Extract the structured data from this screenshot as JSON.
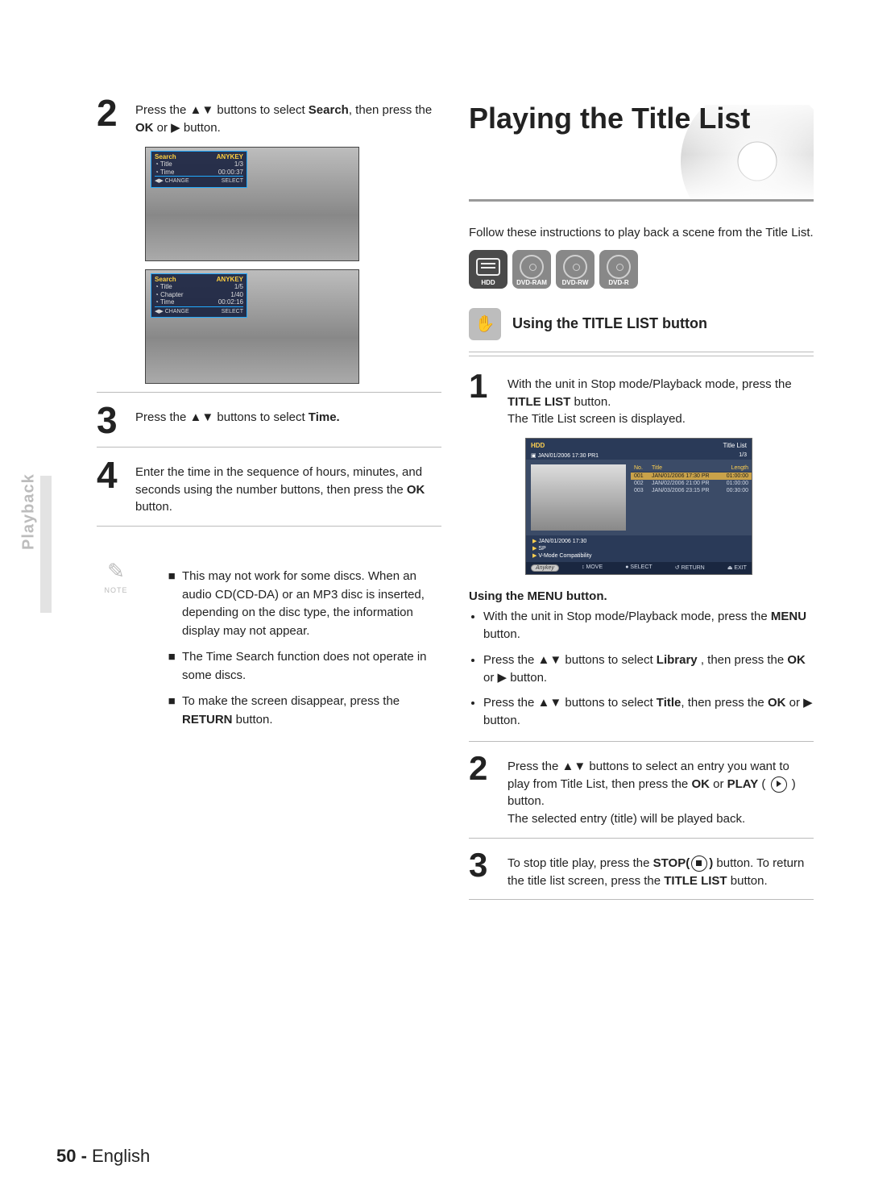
{
  "side_tab": "Playback",
  "footer": {
    "page": "50 -",
    "lang": "English"
  },
  "left": {
    "step2": {
      "pre": "Press the ▲▼ buttons to select ",
      "bold": "Search",
      "post": ", then press the ",
      "bold2": "OK",
      "tail": " or ▶ button."
    },
    "ss1": {
      "hdr_l": "Search",
      "hdr_r": "ANYKEY",
      "r1a": "Title",
      "r1b": "1/3",
      "r2a": "Time",
      "r2b": "00:00:37",
      "botL": "◀▶ CHANGE",
      "botR": "SELECT"
    },
    "ss2": {
      "hdr_l": "Search",
      "hdr_r": "ANYKEY",
      "r1a": "Title",
      "r1b": "1/5",
      "r2a": "Chapter",
      "r2b": "1/40",
      "r3a": "Time",
      "r3b": "00:02:16",
      "botL": "◀▶ CHANGE",
      "botR": "SELECT"
    },
    "step3": {
      "pre": "Press the ▲▼ buttons to select ",
      "bold": "Time."
    },
    "step4": {
      "text": "Enter the time in the sequence of hours, minutes, and seconds using the number buttons, then press the ",
      "bold": "OK",
      "tail": " button."
    },
    "note_label": "NOTE",
    "notes": [
      "This may not work for some discs. When an audio CD(CD-DA) or an MP3 disc is inserted, depending on the disc type, the information display may not appear.",
      "The Time Search function does not operate in some discs.",
      {
        "pre": "To make the screen disappear, press the ",
        "bold": "RETURN",
        "post": " button."
      }
    ]
  },
  "right": {
    "banner_title": "Playing the Title List",
    "intro": "Follow these instructions to play back a scene from the Title List.",
    "media": [
      "HDD",
      "DVD-RAM",
      "DVD-RW",
      "DVD-R"
    ],
    "subhead": "Using the TITLE LIST button",
    "step1": {
      "a": "With the unit in Stop mode/Playback mode, press the ",
      "bold": "TITLE LIST",
      "b": " button.",
      "c": "The Title List screen is displayed."
    },
    "tls": {
      "top_label": "HDD",
      "top_title": "Title List",
      "top_count": "1/3",
      "date_line": "JAN/01/2006 17:30 PR1",
      "head": [
        "No.",
        "Title",
        "Length"
      ],
      "rows": [
        {
          "n": "001",
          "t": "JAN/01/2006 17:30 PR",
          "l": "01:00:00"
        },
        {
          "n": "002",
          "t": "JAN/02/2006 21:00 PR",
          "l": "01:00:00"
        },
        {
          "n": "003",
          "t": "JAN/03/2006 23:15 PR",
          "l": "00:30:00"
        }
      ],
      "meta1": "JAN/01/2006 17:30",
      "meta2": "SP",
      "meta3": "V-Mode Compatibility",
      "foot": [
        "Anykey",
        "MOVE",
        "SELECT",
        "RETURN",
        "EXIT"
      ]
    },
    "menu_head": "Using the MENU button.",
    "menu_b1a": "With the unit in Stop mode/Playback mode, press the ",
    "menu_b1bold": "MENU",
    "menu_b1b": " button.",
    "menu_b2a": "Press the ▲▼ buttons to select ",
    "menu_b2bold": "Library",
    "menu_b2b": " , then press the ",
    "menu_b2bold2": "OK",
    "menu_b2c": " or ▶ button.",
    "menu_b3a": "Press the ▲▼ buttons to select ",
    "menu_b3bold": "Title",
    "menu_b3b": ", then press the ",
    "menu_b3bold2": "OK",
    "menu_b3c": " or ▶ button.",
    "step2": {
      "a": "Press the ▲▼ buttons to select an entry you want to play from Title List, then press the ",
      "bold": "OK",
      "b": " or ",
      "bold2": "PLAY",
      "c": " ( ",
      "d": " ) button.",
      "e": "The selected entry (title) will be played back."
    },
    "step3": {
      "a": "To stop title play, press the ",
      "bold": "STOP(",
      "b": ")",
      "c": " button. To return the title list screen, press the ",
      "bold2": "TITLE LIST",
      "d": " button."
    }
  }
}
